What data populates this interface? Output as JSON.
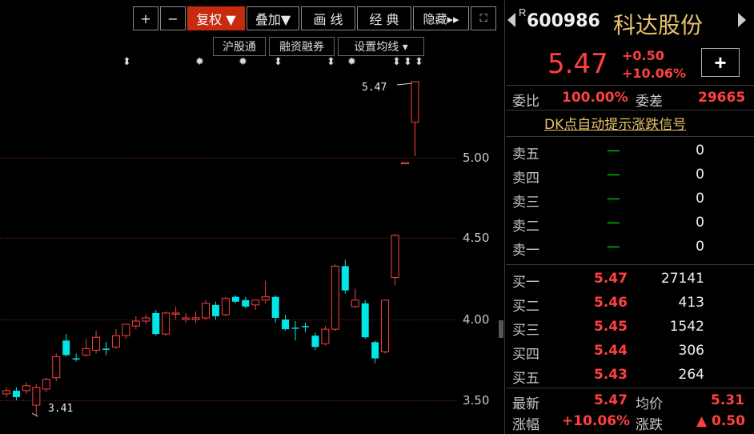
{
  "toolbar": {
    "plus": "+",
    "minus": "−",
    "fuquan": "复权 ▼",
    "diejia": "叠加▼",
    "huaxian": "画 线",
    "jingdian": "经 典",
    "yincang": "隐藏▸▸",
    "expand": "⛶"
  },
  "subtoolbar": {
    "hgt": "沪股通",
    "rzrq": "融资融券",
    "junxian": "设置均线 ▾"
  },
  "chart": {
    "y_ticks": [
      "5.00",
      "4.50",
      "4.00",
      "3.50"
    ],
    "high_label": "5.47",
    "low_label": "3.41"
  },
  "chart_data": {
    "type": "candlestick",
    "ylim": [
      3.38,
      5.55
    ],
    "y_ticks": [
      5.0,
      4.5,
      4.0,
      3.5
    ],
    "candles": [
      {
        "o": 3.54,
        "c": 3.56,
        "h": 3.58,
        "l": 3.52,
        "dir": "up"
      },
      {
        "o": 3.56,
        "c": 3.52,
        "h": 3.58,
        "l": 3.5,
        "dir": "down"
      },
      {
        "o": 3.56,
        "c": 3.59,
        "h": 3.61,
        "l": 3.54,
        "dir": "up"
      },
      {
        "o": 3.58,
        "c": 3.47,
        "h": 3.6,
        "l": 3.41,
        "dir": "up"
      },
      {
        "o": 3.57,
        "c": 3.63,
        "h": 3.64,
        "l": 3.55,
        "dir": "up"
      },
      {
        "o": 3.64,
        "c": 3.77,
        "h": 3.79,
        "l": 3.62,
        "dir": "up"
      },
      {
        "o": 3.87,
        "c": 3.78,
        "h": 3.91,
        "l": 3.77,
        "dir": "down"
      },
      {
        "o": 3.76,
        "c": 3.76,
        "h": 3.79,
        "l": 3.74,
        "dir": "down"
      },
      {
        "o": 3.78,
        "c": 3.82,
        "h": 3.88,
        "l": 3.77,
        "dir": "up"
      },
      {
        "o": 3.81,
        "c": 3.89,
        "h": 3.93,
        "l": 3.79,
        "dir": "up"
      },
      {
        "o": 3.82,
        "c": 3.82,
        "h": 3.86,
        "l": 3.78,
        "dir": "down"
      },
      {
        "o": 3.83,
        "c": 3.9,
        "h": 3.94,
        "l": 3.82,
        "dir": "up"
      },
      {
        "o": 3.9,
        "c": 3.97,
        "h": 3.97,
        "l": 3.88,
        "dir": "up"
      },
      {
        "o": 3.99,
        "c": 3.96,
        "h": 4.02,
        "l": 3.94,
        "dir": "up"
      },
      {
        "o": 3.99,
        "c": 4.01,
        "h": 4.03,
        "l": 3.97,
        "dir": "up"
      },
      {
        "o": 4.04,
        "c": 3.91,
        "h": 4.06,
        "l": 3.9,
        "dir": "down"
      },
      {
        "o": 3.91,
        "c": 4.04,
        "h": 4.05,
        "l": 3.9,
        "dir": "up"
      },
      {
        "o": 4.04,
        "c": 4.04,
        "h": 4.08,
        "l": 4.0,
        "dir": "up"
      },
      {
        "o": 4.0,
        "c": 4.01,
        "h": 4.04,
        "l": 3.98,
        "dir": "up"
      },
      {
        "o": 4.01,
        "c": 4.0,
        "h": 4.05,
        "l": 3.98,
        "dir": "up"
      },
      {
        "o": 4.01,
        "c": 4.1,
        "h": 4.12,
        "l": 4.0,
        "dir": "up"
      },
      {
        "o": 4.09,
        "c": 4.02,
        "h": 4.11,
        "l": 4.0,
        "dir": "down"
      },
      {
        "o": 4.03,
        "c": 4.13,
        "h": 4.14,
        "l": 4.02,
        "dir": "up"
      },
      {
        "o": 4.14,
        "c": 4.11,
        "h": 4.15,
        "l": 4.1,
        "dir": "down"
      },
      {
        "o": 4.12,
        "c": 4.08,
        "h": 4.14,
        "l": 4.07,
        "dir": "down"
      },
      {
        "o": 4.09,
        "c": 4.12,
        "h": 4.12,
        "l": 4.06,
        "dir": "up"
      },
      {
        "o": 4.14,
        "c": 4.12,
        "h": 4.24,
        "l": 4.1,
        "dir": "up"
      },
      {
        "o": 4.14,
        "c": 4.01,
        "h": 4.15,
        "l": 3.98,
        "dir": "down"
      },
      {
        "o": 4.0,
        "c": 3.94,
        "h": 4.03,
        "l": 3.93,
        "dir": "down"
      },
      {
        "o": 3.95,
        "c": 3.95,
        "h": 3.99,
        "l": 3.87,
        "dir": "down"
      },
      {
        "o": 3.96,
        "c": 3.96,
        "h": 3.98,
        "l": 3.92,
        "dir": "down"
      },
      {
        "o": 3.9,
        "c": 3.83,
        "h": 3.92,
        "l": 3.81,
        "dir": "down"
      },
      {
        "o": 3.85,
        "c": 3.94,
        "h": 3.96,
        "l": 3.84,
        "dir": "up"
      },
      {
        "o": 3.94,
        "c": 4.33,
        "h": 4.34,
        "l": 3.93,
        "dir": "up"
      },
      {
        "o": 4.33,
        "c": 4.18,
        "h": 4.37,
        "l": 4.16,
        "dir": "down"
      },
      {
        "o": 4.08,
        "c": 4.12,
        "h": 4.19,
        "l": 4.07,
        "dir": "up"
      },
      {
        "o": 4.1,
        "c": 3.89,
        "h": 4.12,
        "l": 3.88,
        "dir": "down"
      },
      {
        "o": 3.86,
        "c": 3.76,
        "h": 3.87,
        "l": 3.73,
        "dir": "down"
      },
      {
        "o": 3.8,
        "c": 4.12,
        "h": 4.12,
        "l": 3.79,
        "dir": "up"
      },
      {
        "o": 4.26,
        "c": 4.52,
        "h": 4.53,
        "l": 4.21,
        "dir": "up"
      },
      {
        "o": 4.97,
        "c": 4.97,
        "h": 4.97,
        "l": 4.97,
        "dir": "up"
      },
      {
        "o": 5.22,
        "c": 5.47,
        "h": 5.47,
        "l": 5.01,
        "dir": "up"
      }
    ]
  },
  "quote": {
    "code_prefix": "R",
    "code": "600986",
    "name": "科达股份",
    "price": "5.47",
    "change": "+0.50",
    "change_pct": "+10.06%",
    "add_label": "+",
    "weibi_label": "委比",
    "weibi_value": "100.00%",
    "weicha_label": "委差",
    "weicha_value": "29665",
    "dk_link": "DK点自动提示涨跌信号"
  },
  "sell_orders": [
    {
      "label": "卖五",
      "price": "—",
      "vol": "0"
    },
    {
      "label": "卖四",
      "price": "—",
      "vol": "0"
    },
    {
      "label": "卖三",
      "price": "—",
      "vol": "0"
    },
    {
      "label": "卖二",
      "price": "—",
      "vol": "0"
    },
    {
      "label": "卖一",
      "price": "—",
      "vol": "0"
    }
  ],
  "buy_orders": [
    {
      "label": "买一",
      "price": "5.47",
      "vol": "27141"
    },
    {
      "label": "买二",
      "price": "5.46",
      "vol": "413"
    },
    {
      "label": "买三",
      "price": "5.45",
      "vol": "1542"
    },
    {
      "label": "买四",
      "price": "5.44",
      "vol": "306"
    },
    {
      "label": "买五",
      "price": "5.43",
      "vol": "264"
    }
  ],
  "stats": {
    "latest_label": "最新",
    "latest_value": "5.47",
    "avg_label": "均价",
    "avg_value": "5.31",
    "pct_label": "涨幅",
    "pct_value": "+10.06%",
    "zd_label": "涨跌",
    "zd_value": "▲ 0.50"
  },
  "colors": {
    "up": "#ff4040",
    "down": "#00e5e5",
    "grid": "#6a1c1c",
    "accent": "#c62a0f"
  }
}
